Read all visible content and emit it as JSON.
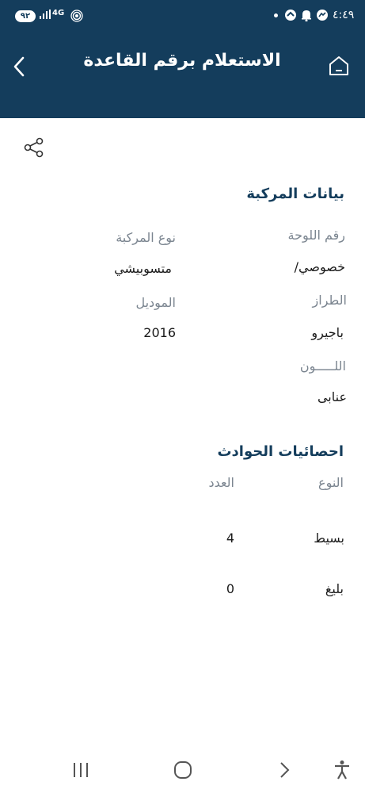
{
  "status_bar": {
    "time": "٤:٤٩",
    "battery": "٩٢",
    "network": "4G",
    "icons": [
      "messenger-icon",
      "bell-icon",
      "sync-icon",
      "dot-icon",
      "hotspot-icon",
      "signal-icon"
    ]
  },
  "header": {
    "title": "الاستعلام برقم القاعدة",
    "back_icon": "chevron-left-icon",
    "home_icon": "home-icon",
    "background": "#143d5c"
  },
  "share_icon": "share-icon",
  "vehicle": {
    "section_title": "بيانات المركبة",
    "plate_label": "رقم اللوحة",
    "plate_value": "خصوصي/",
    "type_label": "نوع المركبة",
    "type_value": "متسوبيشي",
    "style_label": "الطراز",
    "style_value": "باجيرو",
    "model_label": "الموديل",
    "model_value": "2016",
    "color_label": "اللـــــون",
    "color_value": "عنابى"
  },
  "accidents": {
    "section_title": "احصائيات الحوادث",
    "col_type": "النوع",
    "col_count": "العدد",
    "rows": [
      {
        "type": "بسيط",
        "count": "4"
      },
      {
        "type": "بليغ",
        "count": "0"
      }
    ]
  },
  "nav": {
    "icons": [
      "recent-apps-icon",
      "home-circle-icon",
      "back-icon",
      "accessibility-icon"
    ]
  }
}
